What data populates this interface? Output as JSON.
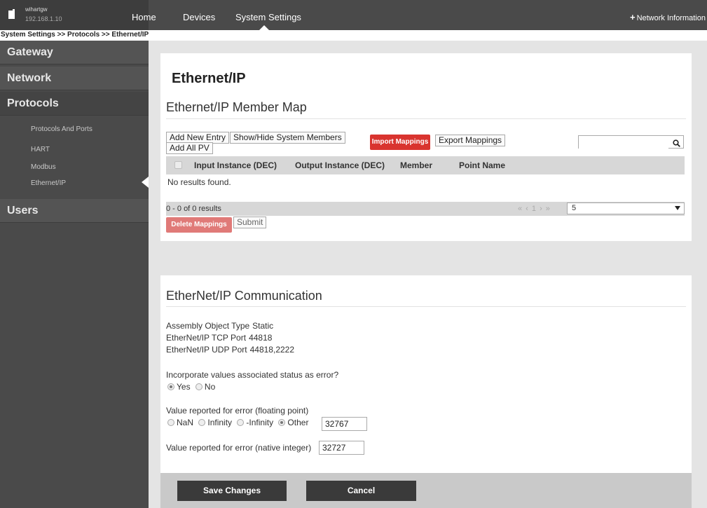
{
  "topbar": {
    "device_name": "wihartgw",
    "device_ip": "192.168.1.10",
    "nav": [
      "Home",
      "Devices",
      "System Settings"
    ],
    "network_info": "Network Information"
  },
  "breadcrumb": "System Settings >> Protocols >> Ethernet/IP",
  "sidebar": {
    "sections": [
      "Gateway",
      "Network",
      "Protocols",
      "Users"
    ],
    "protocol_items": [
      "Protocols And Ports",
      "HART",
      "Modbus",
      "Ethernet/IP"
    ],
    "active_item": "Ethernet/IP"
  },
  "member_map": {
    "page_title": "Ethernet/IP",
    "title": "Ethernet/IP Member Map",
    "buttons": {
      "add_new": "Add New Entry",
      "show_hide": "Show/Hide System Members",
      "add_all_pv": "Add All PV",
      "import": "Import Mappings",
      "export": "Export Mappings",
      "delete": "Delete Mappings",
      "submit": "Submit"
    },
    "search": {
      "placeholder": "",
      "value": ""
    },
    "columns": [
      "Input Instance (DEC)",
      "Output Instance (DEC)",
      "Member",
      "Point Name"
    ],
    "rows": [],
    "empty_text": "No results found.",
    "pagination": {
      "summary": "0 - 0 of 0 results",
      "links": "« ‹ 1 › »",
      "page_size": "5"
    }
  },
  "communication": {
    "title": "EtherNet/IP Communication",
    "info": [
      {
        "label": "Assembly Object Type",
        "value": "Static"
      },
      {
        "label": "EtherNet/IP TCP Port",
        "value": "44818"
      },
      {
        "label": "EtherNet/IP UDP Port",
        "value": "44818,2222"
      }
    ],
    "status_question": "Incorporate values associated status as error?",
    "status_options": [
      "Yes",
      "No"
    ],
    "status_selected": "Yes",
    "float_question": "Value reported for error (floating point)",
    "float_options": [
      "NaN",
      "Infinity",
      "-Infinity",
      "Other"
    ],
    "float_selected": "Other",
    "float_value": "32767",
    "int_question": "Value reported for error (native integer)",
    "int_value": "32727"
  },
  "footer": {
    "save": "Save Changes",
    "cancel": "Cancel"
  },
  "colors": {
    "accent_red": "#d9342f",
    "dark": "#4a4a4a"
  }
}
